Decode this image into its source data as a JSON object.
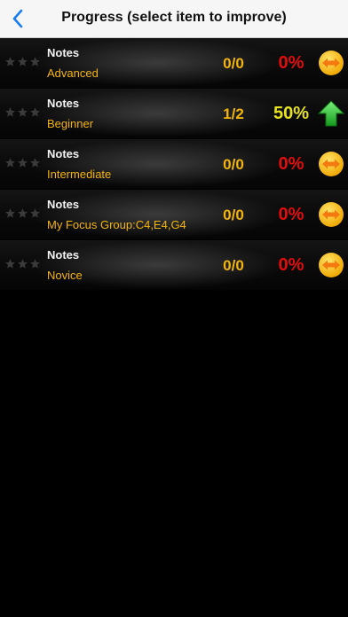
{
  "header": {
    "title": "Progress (select item to improve)"
  },
  "colors": {
    "accent_blue": "#1a7df5",
    "gold": "#f3b40a",
    "red": "#e10c0c",
    "yellow": "#e6e21c",
    "green": "#25c234"
  },
  "items": [
    {
      "title": "Notes",
      "subtitle": "Advanced",
      "score": "0/0",
      "percent": "0%",
      "trend": "sideways-arrow-icon",
      "stars_filled": 0
    },
    {
      "title": "Notes",
      "subtitle": "Beginner",
      "score": "1/2",
      "percent": "50%",
      "trend": "up-arrow-icon",
      "stars_filled": 0
    },
    {
      "title": "Notes",
      "subtitle": "Intermediate",
      "score": "0/0",
      "percent": "0%",
      "trend": "sideways-arrow-icon",
      "stars_filled": 0
    },
    {
      "title": "Notes",
      "subtitle": "My Focus Group:C4,E4,G4",
      "score": "0/0",
      "percent": "0%",
      "trend": "sideways-arrow-icon",
      "stars_filled": 0
    },
    {
      "title": "Notes",
      "subtitle": "Novice",
      "score": "0/0",
      "percent": "0%",
      "trend": "sideways-arrow-icon",
      "stars_filled": 0
    }
  ]
}
